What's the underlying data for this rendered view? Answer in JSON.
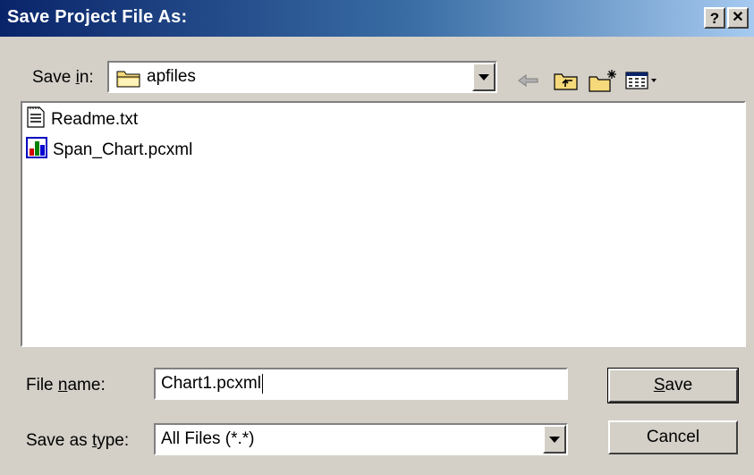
{
  "window": {
    "title": "Save Project File As:",
    "help_label": "?",
    "close_label": "✕"
  },
  "save_in": {
    "label_pre": "Save ",
    "label_mnemonic": "i",
    "label_post": "n:",
    "value": "apfiles"
  },
  "toolbar": {
    "back_icon": "back-arrow-icon",
    "up_icon": "up-folder-icon",
    "new_folder_icon": "new-folder-icon",
    "view_menu_icon": "view-menu-icon"
  },
  "files": [
    {
      "name": "Readme.txt",
      "icon": "text-file-icon"
    },
    {
      "name": "Span_Chart.pcxml",
      "icon": "chart-file-icon"
    }
  ],
  "file_name": {
    "label_pre": "File ",
    "label_mnemonic": "n",
    "label_post": "ame:",
    "value": "Chart1.pcxml"
  },
  "save_as_type": {
    "label_pre": "Save as ",
    "label_mnemonic": "t",
    "label_post": "ype:",
    "value": "All Files (*.*)"
  },
  "buttons": {
    "save_mnemonic": "S",
    "save_rest": "ave",
    "cancel": "Cancel"
  },
  "colors": {
    "title_start": "#0a246a",
    "title_end": "#a6caf0",
    "face": "#d4d0c8"
  }
}
